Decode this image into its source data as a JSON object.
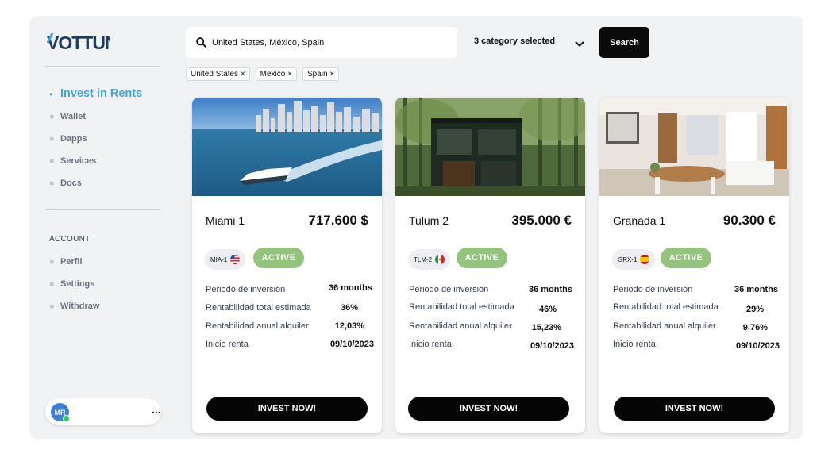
{
  "sidebar": {
    "logo_text": "VOTTUN",
    "nav": [
      {
        "label": "Invest in Rents",
        "active": true
      },
      {
        "label": "Wallet"
      },
      {
        "label": "Dapps"
      },
      {
        "label": "Services"
      },
      {
        "label": "Docs"
      }
    ],
    "account_label": "ACCOUNT",
    "account_items": [
      {
        "label": "Perfil"
      },
      {
        "label": "Settings"
      },
      {
        "label": "Withdraw"
      }
    ],
    "user": {
      "initials": "MR",
      "menu_label": "..."
    }
  },
  "search": {
    "value": "United States, México, Spain",
    "category_label": "3 category selected",
    "button_label": "Search"
  },
  "filters": [
    "United States ×",
    "Mexico ×",
    "Spain ×"
  ],
  "colors": {
    "accent": "#3aa6e0",
    "active_badge": "#93c47d",
    "button": "#050505"
  },
  "properties": [
    {
      "name": "Miami 1",
      "price": "717.600 $",
      "code": "MIA-1",
      "flag_icon": "usa-flag-icon",
      "status": "ACTIVE",
      "rows": [
        {
          "label": "Periodo de inversión",
          "value": "36 months"
        },
        {
          "label": "Rentabilidad total estimada",
          "value": "36%"
        },
        {
          "label": "Rentabilidad anual alquiler",
          "value": "12,03%"
        },
        {
          "label": "Inicio renta",
          "value": "09/10/2023"
        }
      ],
      "cta": "INVEST NOW!"
    },
    {
      "name": "Tulum 2",
      "price": "395.000 €",
      "code": "TLM-2",
      "flag_icon": "mexico-flag-icon",
      "status": "ACTIVE",
      "rows": [
        {
          "label": "Periodo de inversión",
          "value": "36 months"
        },
        {
          "label": "Rentabilidad total estimada",
          "value": "46%"
        },
        {
          "label": "Rentabilidad anual alquiler",
          "value": "15,23%"
        },
        {
          "label": "Inicio renta",
          "value": "09/10/2023"
        }
      ],
      "cta": "INVEST NOW!"
    },
    {
      "name": "Granada 1",
      "price": "90.300 €",
      "code": "GRX-1",
      "flag_icon": "spain-flag-icon",
      "status": "ACTIVE",
      "rows": [
        {
          "label": "Periodo de inversión",
          "value": "36 months"
        },
        {
          "label": "Rentabilidad total estimada",
          "value": "29%"
        },
        {
          "label": "Rentabilidad anual alquiler",
          "value": "9,76%"
        },
        {
          "label": "Inicio renta",
          "value": "09/10/2023"
        }
      ],
      "cta": "INVEST NOW!"
    }
  ]
}
